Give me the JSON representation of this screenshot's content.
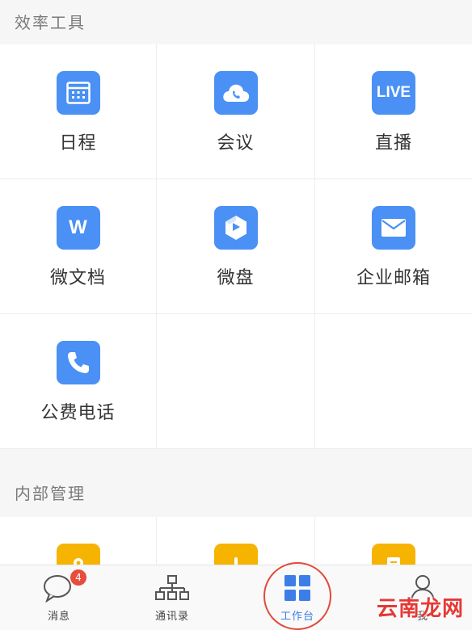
{
  "section1": {
    "title": "效率工具",
    "items": [
      {
        "label": "日程",
        "icon": "calendar-icon"
      },
      {
        "label": "会议",
        "icon": "cloud-phone-icon"
      },
      {
        "label": "直播",
        "icon": "live-icon",
        "icon_text": "LIVE"
      },
      {
        "label": "微文档",
        "icon": "document-icon",
        "icon_text": "W"
      },
      {
        "label": "微盘",
        "icon": "drive-icon"
      },
      {
        "label": "企业邮箱",
        "icon": "mail-icon"
      },
      {
        "label": "公费电话",
        "icon": "phone-icon"
      }
    ]
  },
  "section2": {
    "title": "内部管理"
  },
  "tabbar": {
    "items": [
      {
        "label": "消息",
        "badge": "4",
        "icon": "message-icon"
      },
      {
        "label": "通讯录",
        "icon": "org-chart-icon"
      },
      {
        "label": "工作台",
        "icon": "grid-icon",
        "active": true
      },
      {
        "label": "我",
        "icon": "person-icon"
      }
    ]
  },
  "watermark": "云南龙网",
  "colors": {
    "accent": "#4a90f5",
    "active_tab": "#3d7de8",
    "badge": "#e74c3c",
    "highlight": "#e04a3a",
    "yellow_icon": "#f6b400"
  }
}
